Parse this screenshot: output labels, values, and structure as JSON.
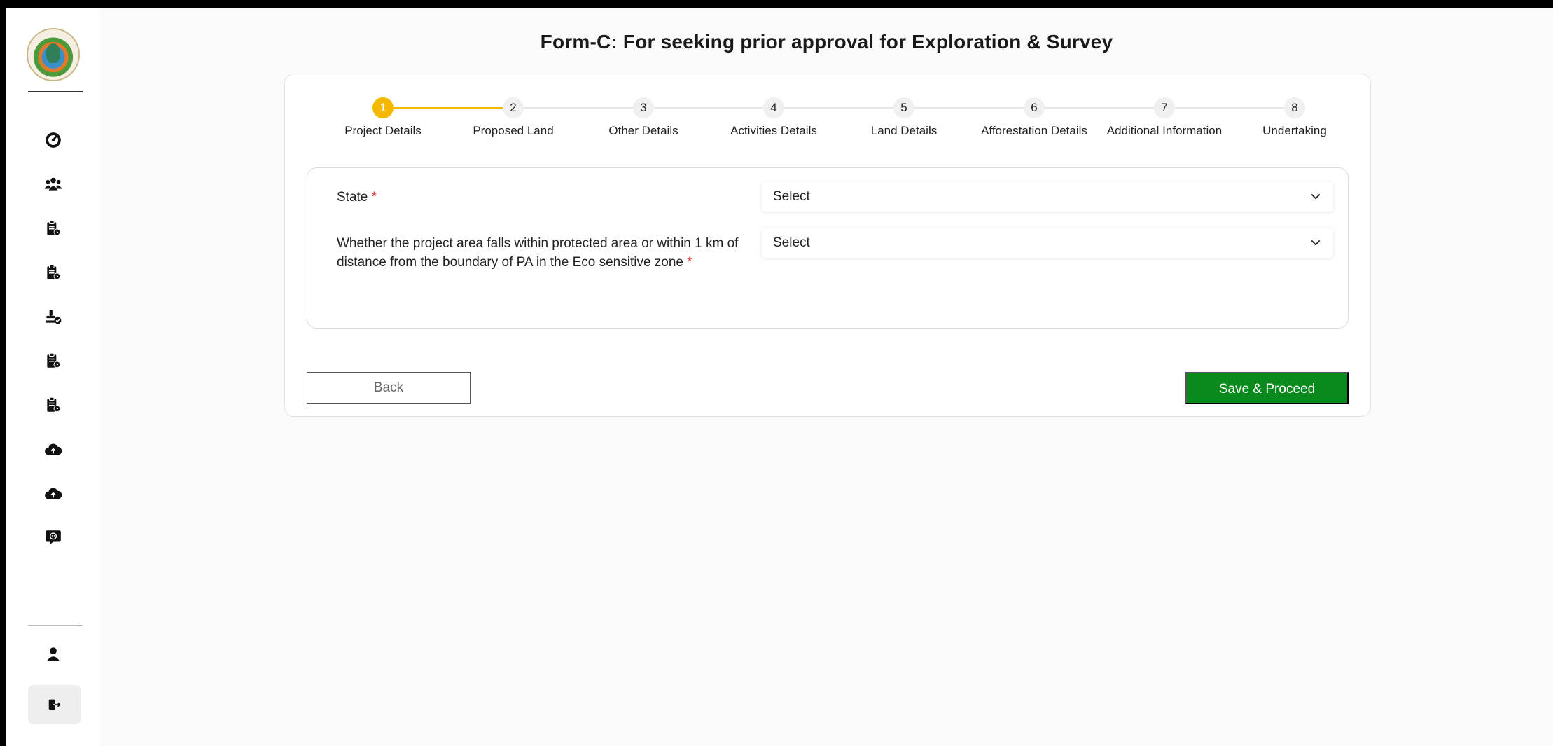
{
  "page": {
    "title": "Form-C: For seeking prior approval for Exploration & Survey"
  },
  "sidebar": {
    "logo": "ministry-emblem-logo",
    "items": [
      {
        "name": "dashboard",
        "icon": "gauge-icon"
      },
      {
        "name": "users",
        "icon": "users-group-icon"
      },
      {
        "name": "applications-1",
        "icon": "clipboard-clock-icon"
      },
      {
        "name": "applications-2",
        "icon": "clipboard-clock-icon"
      },
      {
        "name": "approvals",
        "icon": "stamp-check-icon"
      },
      {
        "name": "applications-3",
        "icon": "clipboard-clock-icon"
      },
      {
        "name": "applications-4",
        "icon": "clipboard-clock-icon"
      },
      {
        "name": "upload-1",
        "icon": "cloud-upload-icon"
      },
      {
        "name": "upload-2",
        "icon": "cloud-upload-icon"
      },
      {
        "name": "feedback",
        "icon": "chat-message-icon"
      }
    ],
    "profile_icon": "user-icon",
    "logout_icon": "logout-icon"
  },
  "stepper": {
    "active_index": 0,
    "steps": [
      {
        "number": "1",
        "label": "Project Details"
      },
      {
        "number": "2",
        "label": "Proposed Land"
      },
      {
        "number": "3",
        "label": "Other Details"
      },
      {
        "number": "4",
        "label": "Activities Details"
      },
      {
        "number": "5",
        "label": "Land Details"
      },
      {
        "number": "6",
        "label": "Afforestation Details"
      },
      {
        "number": "7",
        "label": "Additional Information"
      },
      {
        "number": "8",
        "label": "Undertaking"
      }
    ]
  },
  "form": {
    "fields": [
      {
        "label": "State",
        "required_mark": "*",
        "value": "Select"
      },
      {
        "label": "Whether the project area falls within protected area or within 1 km of distance from the boundary of PA in the Eco sensitive zone",
        "required_mark": "*",
        "value": "Select"
      }
    ]
  },
  "actions": {
    "back_label": "Back",
    "save_label": "Save & Proceed"
  },
  "colors": {
    "accent_step": "#f5b800",
    "primary_button": "#0a8a1c",
    "required": "#e53935"
  }
}
